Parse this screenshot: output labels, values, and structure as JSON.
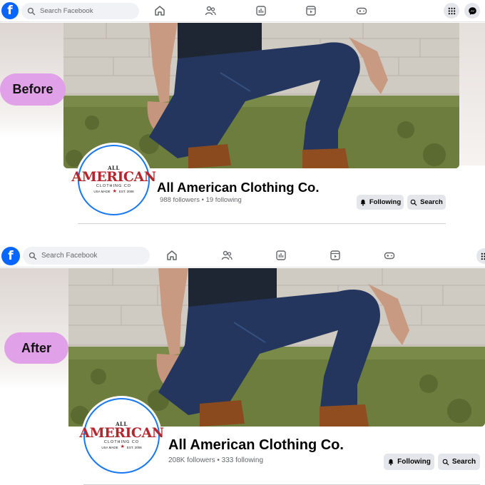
{
  "search": {
    "placeholder": "Search Facebook"
  },
  "nav_icons": [
    "home-icon",
    "friends-icon",
    "feeds-icon",
    "reels-icon",
    "gaming-icon"
  ],
  "right_icons": [
    "menu-grid-icon",
    "messenger-icon"
  ],
  "colors": {
    "facebook_blue": "#0866ff",
    "label_pill": "#e1a1e8",
    "logo_red": "#b3262d"
  },
  "before": {
    "label": "Before",
    "page_name": "All American Clothing Co.",
    "stats": "988 followers • 19 following",
    "following_label": "Following",
    "search_label": "Search"
  },
  "after": {
    "label": "After",
    "page_name": "All American Clothing Co.",
    "stats": "208K followers • 333 following",
    "following_label": "Following",
    "search_label": "Search"
  },
  "logo": {
    "line1": "ALL",
    "line2": "AMERICAN",
    "line3": "CLOTHING CO",
    "left": "USA MADE",
    "right": "EST. 2008"
  }
}
